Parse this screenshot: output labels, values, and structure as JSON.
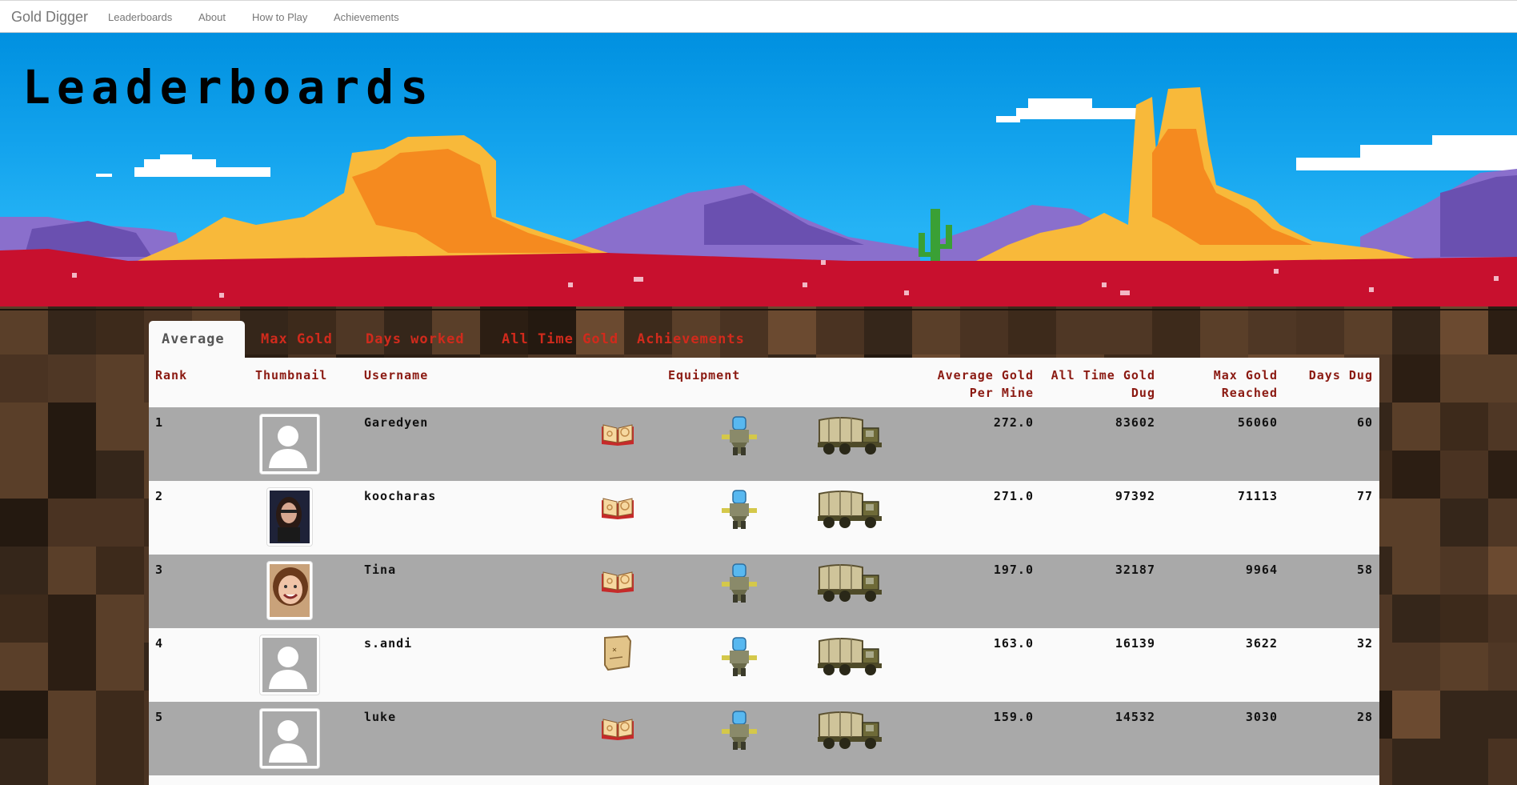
{
  "navbar": {
    "brand": "Gold Digger",
    "links": [
      "Leaderboards",
      "About",
      "How to Play",
      "Achievements"
    ]
  },
  "hero": {
    "title": "Leaderboards"
  },
  "tabs": [
    "Average",
    "Max Gold",
    "Days worked",
    "All Time Gold",
    "Achievements"
  ],
  "active_tab": "Average",
  "table": {
    "headers": {
      "rank": "Rank",
      "thumbnail": "Thumbnail",
      "username": "Username",
      "equipment": "Equipment",
      "avg_line1": "Average Gold",
      "avg_line2": "Per Mine",
      "alltime_line1": "All Time Gold",
      "alltime_line2": "Dug",
      "max_line1": "Max Gold",
      "max_line2": "Reached",
      "days": "Days Dug"
    },
    "rows": [
      {
        "rank": "1",
        "username": "Garedyen",
        "avg": "272.0",
        "alltime": "83602",
        "max": "56060",
        "days": "60",
        "avatar": "default-avatar",
        "equipment": [
          "spellbook-icon",
          "drill-robot-icon",
          "wagon-truck-icon"
        ]
      },
      {
        "rank": "2",
        "username": "koocharas",
        "avg": "271.0",
        "alltime": "97392",
        "max": "71113",
        "days": "77",
        "avatar": "photo-woman",
        "equipment": [
          "spellbook-icon",
          "drill-robot-icon",
          "wagon-truck-icon"
        ]
      },
      {
        "rank": "3",
        "username": "Tina",
        "avg": "197.0",
        "alltime": "32187",
        "max": "9964",
        "days": "58",
        "avatar": "photo-child",
        "equipment": [
          "spellbook-icon",
          "drill-robot-icon",
          "wagon-truck-icon"
        ]
      },
      {
        "rank": "4",
        "username": "s.andi",
        "avg": "163.0",
        "alltime": "16139",
        "max": "3622",
        "days": "32",
        "avatar": "default-avatar",
        "equipment": [
          "treasure-map-icon",
          "drill-robot-icon",
          "wagon-truck-icon"
        ]
      },
      {
        "rank": "5",
        "username": "luke",
        "avg": "159.0",
        "alltime": "14532",
        "max": "3030",
        "days": "28",
        "avatar": "default-avatar",
        "equipment": [
          "spellbook-icon",
          "drill-robot-icon",
          "wagon-truck-icon"
        ]
      }
    ]
  },
  "colors": {
    "tab_text": "#d12a1c",
    "header_text": "#8b1a12",
    "row_gray": "#a9a9a9",
    "row_light": "#fafafa",
    "sky": "#15a5ee",
    "ground": "#c8102e"
  }
}
